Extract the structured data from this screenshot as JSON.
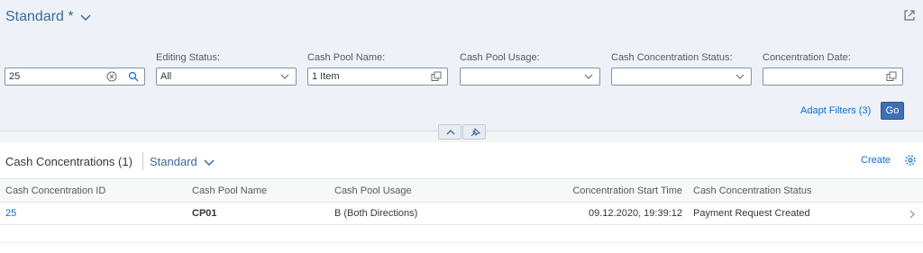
{
  "filterbar": {
    "variant_title": "Standard *",
    "fields": [
      {
        "label": "",
        "value": "25"
      },
      {
        "label": "Editing Status:",
        "value": "All"
      },
      {
        "label": "Cash Pool Name:",
        "value": "1 Item"
      },
      {
        "label": "Cash Pool Usage:",
        "value": ""
      },
      {
        "label": "Cash Concentration Status:",
        "value": ""
      },
      {
        "label": "Concentration Date:",
        "value": ""
      }
    ],
    "adapt_filters_label": "Adapt Filters (3)",
    "go_label": "Go"
  },
  "table": {
    "title": "Cash Concentrations (1)",
    "variant": "Standard",
    "create_label": "Create",
    "columns": [
      "Cash Concentration ID",
      "Cash Pool Name",
      "Cash Pool Usage",
      "Concentration Start Time",
      "Cash Concentration Status"
    ],
    "rows": [
      {
        "id": "25",
        "pool_name": "CP01",
        "usage": "B (Both Directions)",
        "start_time": "09.12.2020, 19:39:12",
        "status": "Payment Request Created"
      }
    ]
  },
  "colors": {
    "accent": "#0a6ed1",
    "variant_blue": "#3f6896",
    "go_button": "#3f6fb5",
    "filterbar_bg": "#eef2f8"
  },
  "icons": {
    "variant": "chevron-down-icon",
    "share": "share-icon",
    "clear": "clear-circle-icon",
    "search": "search-icon",
    "dropdown": "chevron-down-icon",
    "value_help": "value-help-icon",
    "collapse": "chevron-up-icon",
    "pin": "pin-icon",
    "settings": "gear-icon",
    "row_nav": "chevron-right-icon"
  }
}
